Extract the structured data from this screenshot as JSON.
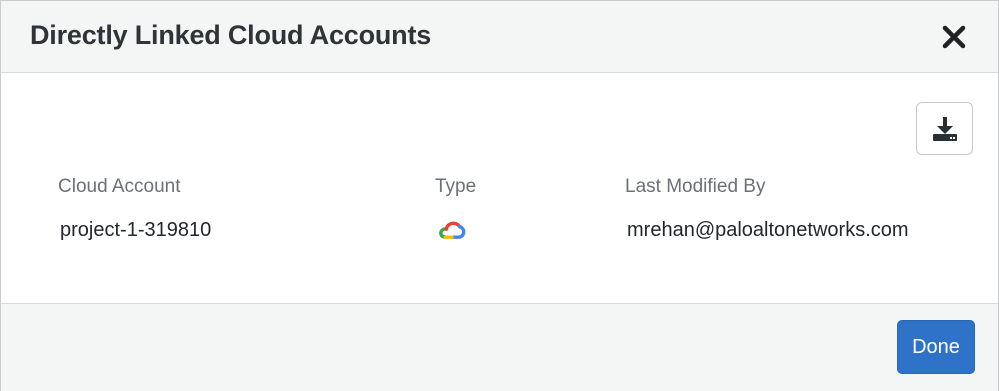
{
  "dialog": {
    "title": "Directly Linked Cloud Accounts",
    "close_icon": "close-icon",
    "download_icon": "download-icon"
  },
  "table": {
    "columns": [
      "Cloud Account",
      "Type",
      "Last Modified By"
    ],
    "rows": [
      {
        "cloud_account": "project-1-319810",
        "type_icon": "google-cloud-icon",
        "last_modified_by": "mrehan@paloaltonetworks.com"
      }
    ]
  },
  "footer": {
    "done_label": "Done"
  },
  "colors": {
    "accent": "#2f73c9",
    "header_bg": "#f4f5f5",
    "title_text": "#2e3438",
    "column_header_text": "#6b7176"
  }
}
